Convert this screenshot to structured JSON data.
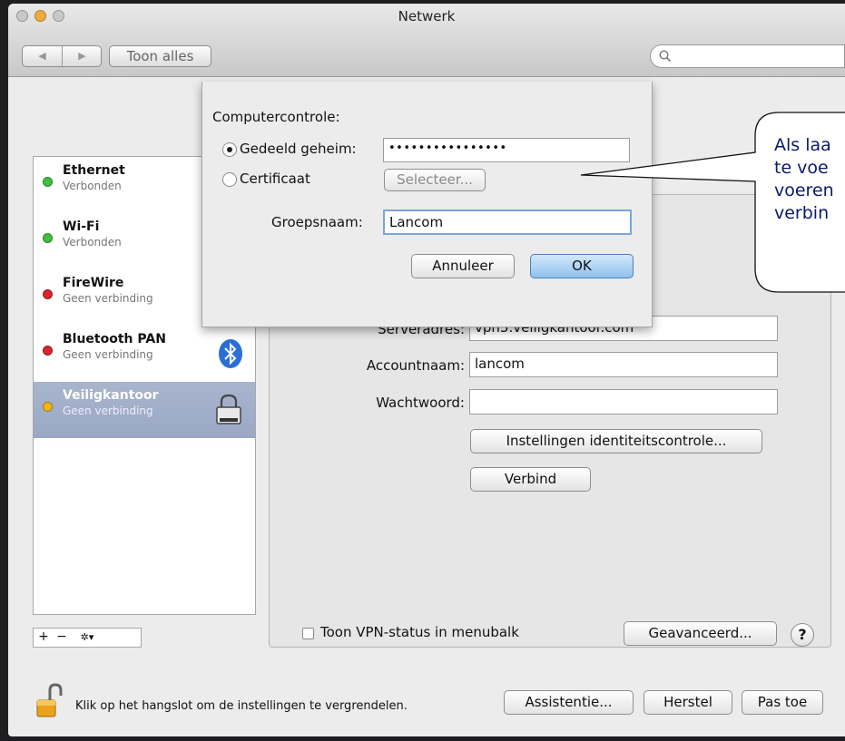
{
  "window": {
    "title": "Netwerk"
  },
  "toolbar": {
    "show_all_label": "Toon alles",
    "search_placeholder": ""
  },
  "services": [
    {
      "name": "Ethernet",
      "status": "Verbonden",
      "state_color": "#3fbf3f"
    },
    {
      "name": "Wi-Fi",
      "status": "Verbonden",
      "state_color": "#3fbf3f"
    },
    {
      "name": "FireWire",
      "status": "Geen verbinding",
      "state_color": "#d7262e"
    },
    {
      "name": "Bluetooth PAN",
      "status": "Geen verbinding",
      "state_color": "#d7262e"
    },
    {
      "name": "Veiligkantoor",
      "status": "Geen verbinding",
      "state_color": "#f2b516",
      "selected": true
    }
  ],
  "sidebar_tools": {
    "add": "+",
    "remove": "−",
    "action": "✲▾"
  },
  "vpn": {
    "server_label": "Serveradres:",
    "server_value": "vpn3.veiligkantoor.com",
    "account_label": "Accountnaam:",
    "account_value": "lancom",
    "password_label": "Wachtwoord:",
    "password_value": "",
    "auth_settings_button": "Instellingen identiteitscontrole...",
    "connect_button": "Verbind",
    "show_status_label": "Toon VPN-status in menubalk",
    "advanced_button": "Geavanceerd...",
    "help_label": "?"
  },
  "sheet": {
    "heading": "Computercontrole:",
    "shared_secret_label": "Gedeeld geheim:",
    "shared_secret_value": "••••••••••••••••",
    "certificate_label": "Certificaat",
    "select_button": "Selecteer...",
    "group_label": "Groepsnaam:",
    "group_value": "Lancom",
    "cancel_button": "Annuleer",
    "ok_button": "OK"
  },
  "bottom": {
    "lock_text": "Klik op het hangslot om de instellingen te vergrendelen.",
    "assist_button": "Assistentie...",
    "revert_button": "Herstel",
    "apply_button": "Pas toe"
  },
  "callout": {
    "line1": "Als laa",
    "line2": "te voe",
    "line3": "voeren",
    "line4": "verbin"
  }
}
